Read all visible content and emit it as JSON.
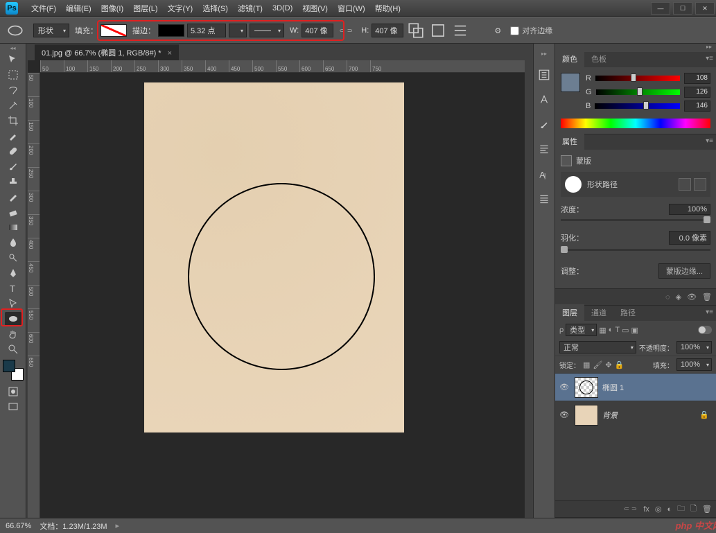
{
  "menu": [
    "文件(F)",
    "编辑(E)",
    "图像(I)",
    "图层(L)",
    "文字(Y)",
    "选择(S)",
    "滤镜(T)",
    "3D(D)",
    "视图(V)",
    "窗口(W)",
    "帮助(H)"
  ],
  "options": {
    "shape_mode": "形状",
    "fill_label": "填充：",
    "stroke_label": "描边：",
    "stroke_width": "5.32 点",
    "W": "W:",
    "W_val": "407 像",
    "H": "H:",
    "H_val": "407 像",
    "align_label": "对齐边缘"
  },
  "doc_tab": "01.jpg @ 66.7% (椭圆 1, RGB/8#) *",
  "ruler_h": [
    "50",
    "100",
    "150",
    "200",
    "250",
    "300",
    "350",
    "400",
    "450",
    "500",
    "550",
    "600",
    "650",
    "700",
    "750"
  ],
  "ruler_v": [
    "50",
    "100",
    "150",
    "200",
    "250",
    "300",
    "350",
    "400",
    "450",
    "500",
    "550",
    "600",
    "650"
  ],
  "color_panel": {
    "tabs": [
      "颜色",
      "色板"
    ],
    "R": "R",
    "G": "G",
    "B": "B",
    "r_val": "108",
    "g_val": "126",
    "b_val": "146"
  },
  "prop_panel": {
    "tab": "属性",
    "mask": "蒙版",
    "shape_path": "形状路径",
    "density_label": "浓度：",
    "density_val": "100%",
    "feather_label": "羽化：",
    "feather_val": "0.0 像素",
    "adjust_label": "调整：",
    "mask_edge": "蒙版边缘..."
  },
  "layers_panel": {
    "tabs": [
      "图层",
      "通道",
      "路径"
    ],
    "filter_label": "类型",
    "filter_icon": "ρ",
    "blend_mode": "正常",
    "opacity_label": "不透明度：",
    "opacity_val": "100%",
    "lock_label": "锁定：",
    "fill_label": "填充：",
    "fill_val": "100%",
    "layer1": "椭圆 1",
    "layer2": "背景"
  },
  "status": {
    "zoom": "66.67%",
    "doc_size": "文档：1.23M/1.23M"
  },
  "watermark": "php 中文网"
}
